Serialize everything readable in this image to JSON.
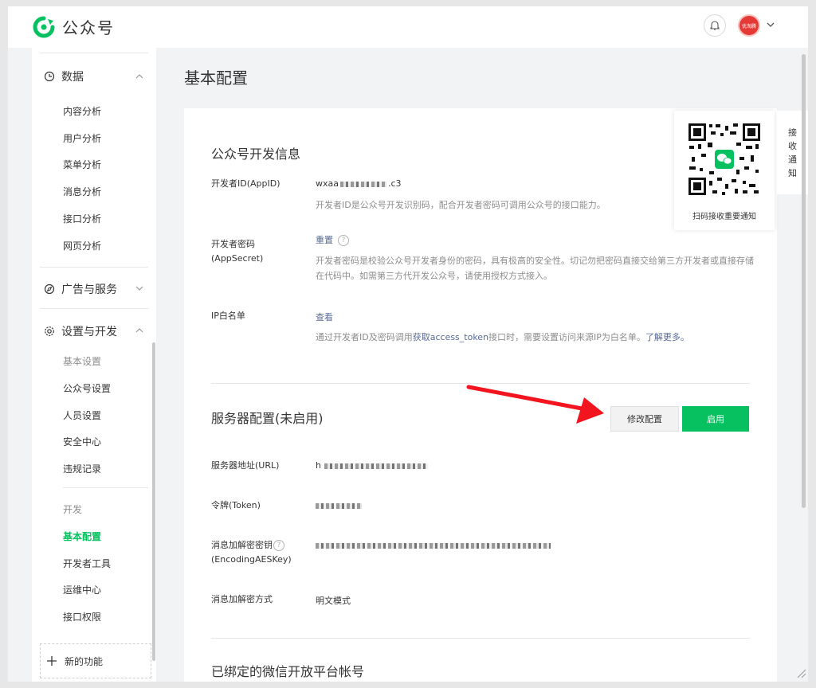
{
  "header": {
    "brand": "公众号",
    "avatar_text": "优淘腾"
  },
  "sidebar": {
    "sections": [
      {
        "label": "数据",
        "items": [
          "内容分析",
          "用户分析",
          "菜单分析",
          "消息分析",
          "接口分析",
          "网页分析"
        ]
      },
      {
        "label": "广告与服务"
      },
      {
        "label": "设置与开发",
        "groups": [
          {
            "label": "基本设置",
            "items": [
              "公众号设置",
              "人员设置",
              "安全中心",
              "违规记录"
            ]
          },
          {
            "label": "开发",
            "items": [
              "基本配置",
              "开发者工具",
              "运维中心",
              "接口权限"
            ]
          }
        ]
      }
    ],
    "new_feature": "新的功能"
  },
  "page": {
    "title": "基本配置"
  },
  "dev_info": {
    "title": "公众号开发信息",
    "appid_label": "开发者ID(AppID)",
    "appid_prefix": "wxaa",
    "appid_suffix": ".c3",
    "appid_desc": "开发者ID是公众号开发识别码，配合开发者密码可调用公众号的接口能力。",
    "secret_label": "开发者密码(AppSecret)",
    "secret_reset": "重置",
    "secret_desc": "开发者密码是校验公众号开发者身份的密码，具有极高的安全性。切记勿把密码直接交给第三方开发者或直接存储在代码中。如需第三方代开发公众号，请使用授权方式接入。",
    "ip_label": "IP白名单",
    "ip_view": "查看",
    "ip_desc_1": "通过开发者ID及密码调用",
    "ip_desc_link": "获取access_token",
    "ip_desc_2": "接口时，需要设置访问来源IP为白名单。",
    "ip_desc_more": "了解更多。"
  },
  "server": {
    "title": "服务器配置(未启用)",
    "modify": "修改配置",
    "enable": "启用",
    "url_label": "服务器地址(URL)",
    "url_prefix": "h",
    "token_label": "令牌(Token)",
    "aes_label_1": "消息加解密密钥",
    "aes_label_2": "(EncodingAESKey)",
    "mode_label": "消息加解密方式",
    "mode_value": "明文模式"
  },
  "bound": {
    "title": "已绑定的微信开放平台帐号"
  },
  "qr": {
    "caption": "扫码接收重要通知"
  },
  "side_tab": [
    "接",
    "收",
    "通",
    "知"
  ],
  "colors": {
    "accent": "#07c160",
    "link": "#576b95",
    "arrow": "#f2151f"
  }
}
